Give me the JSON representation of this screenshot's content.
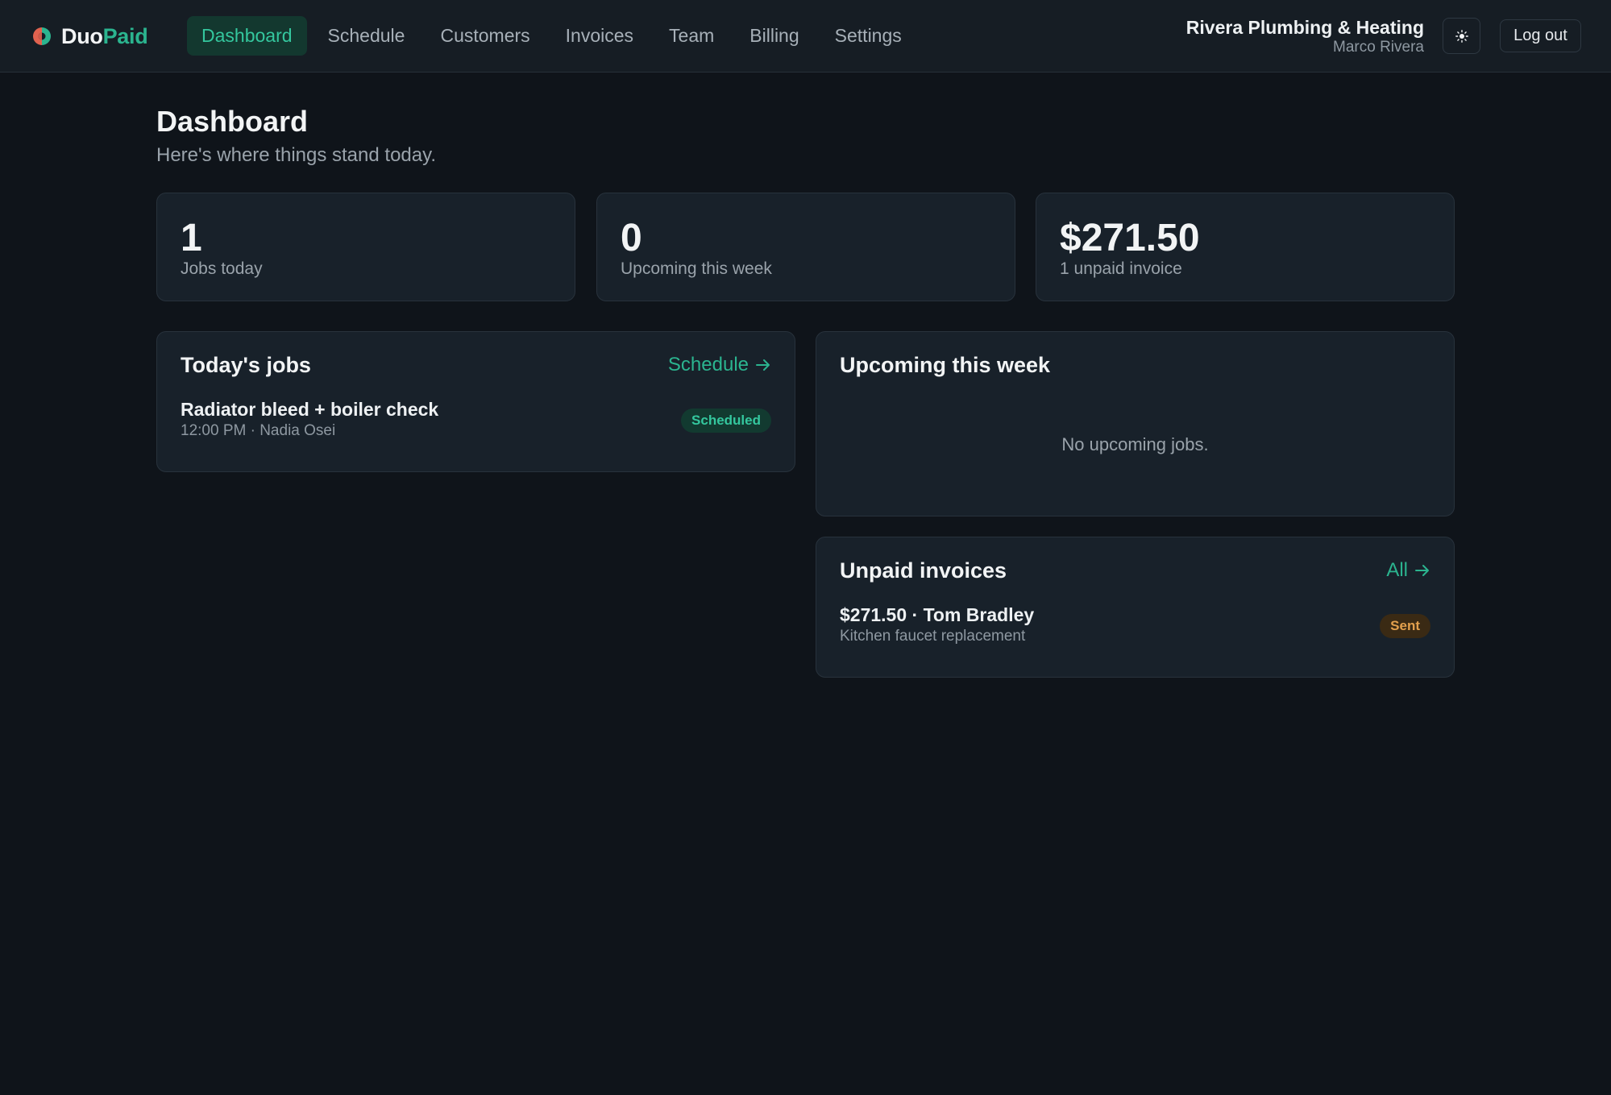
{
  "brand": {
    "name_part1": "Duo",
    "name_part2": "Paid",
    "accent": "#2bb48f",
    "logo_colors": [
      "#e0624f",
      "#2bb48f"
    ]
  },
  "nav": {
    "items": [
      {
        "label": "Dashboard",
        "active": true
      },
      {
        "label": "Schedule"
      },
      {
        "label": "Customers"
      },
      {
        "label": "Invoices"
      },
      {
        "label": "Team"
      },
      {
        "label": "Billing"
      },
      {
        "label": "Settings"
      }
    ]
  },
  "account": {
    "org_name": "Rivera Plumbing & Heating",
    "user_name": "Marco Rivera",
    "theme_icon": "sun-icon",
    "logout_label": "Log out"
  },
  "page": {
    "title": "Dashboard",
    "subtitle": "Here's where things stand today."
  },
  "stats": [
    {
      "value": "1",
      "label": "Jobs today"
    },
    {
      "value": "0",
      "label": "Upcoming this week"
    },
    {
      "value": "$271.50",
      "label": "1 unpaid invoice"
    }
  ],
  "todays_jobs": {
    "title": "Today's jobs",
    "link_label": "Schedule",
    "items": [
      {
        "title": "Radiator bleed + boiler check",
        "subtitle": "12:00 PM · Nadia Osei",
        "status": "Scheduled"
      }
    ]
  },
  "upcoming": {
    "title": "Upcoming this week",
    "empty_text": "No upcoming jobs."
  },
  "unpaid_invoices": {
    "title": "Unpaid invoices",
    "link_label": "All",
    "items": [
      {
        "title": "$271.50 · Tom Bradley",
        "subtitle": "Kitchen faucet replacement",
        "status": "Sent"
      }
    ]
  }
}
